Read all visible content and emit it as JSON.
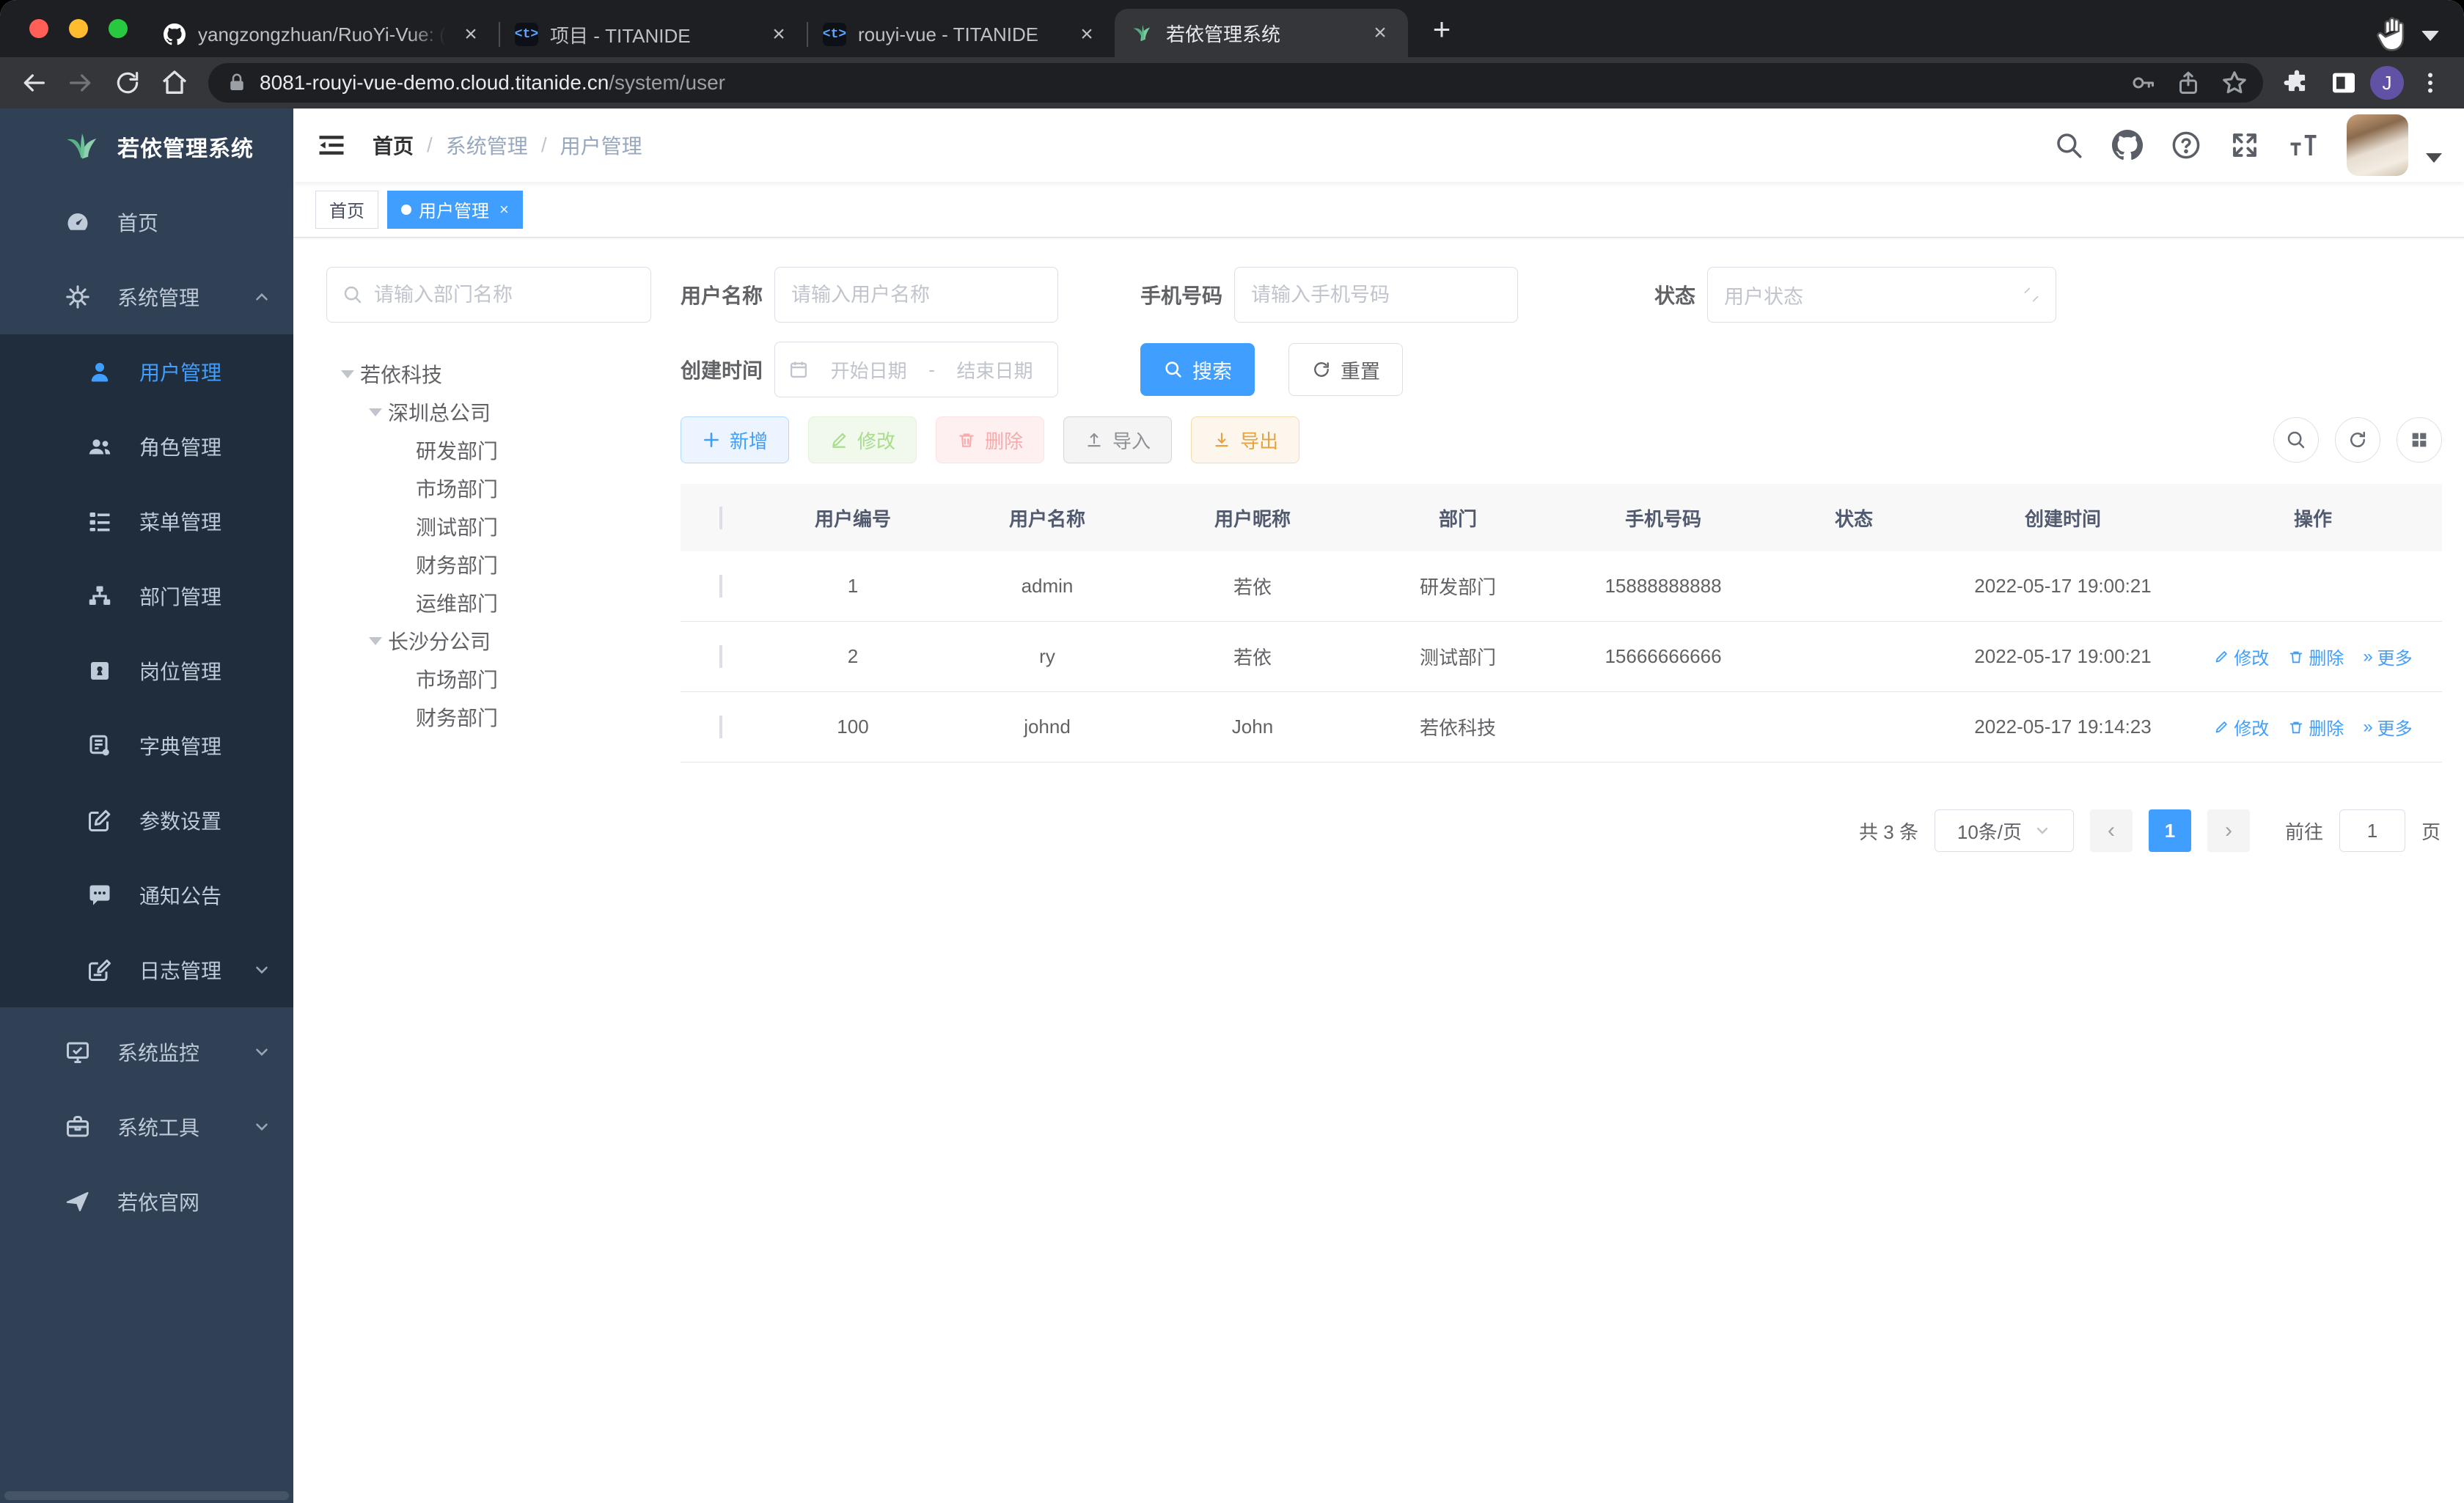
{
  "browser": {
    "tabs": [
      {
        "title": "yangzongzhuan/RuoYi-Vue: (Ru",
        "icon": "github-icon"
      },
      {
        "title": "项目 - TITANIDE",
        "icon": "titanide-code-icon"
      },
      {
        "title": "rouyi-vue - TITANIDE",
        "icon": "titanide-code-icon"
      },
      {
        "title": "若依管理系统",
        "icon": "ruoyi-leaf-icon"
      }
    ],
    "url_host": "8081-rouyi-vue-demo.cloud.titanide.cn",
    "url_path": "/system/user",
    "avatar_letter": "J"
  },
  "icons": {
    "close": "×",
    "new_tab": "+",
    "prev": "‹",
    "next": "›",
    "more": "»",
    "question": "?"
  },
  "sidebar": {
    "logo_title": "若依管理系统",
    "items": [
      {
        "label": "首页"
      },
      {
        "label": "系统管理"
      },
      {
        "label": "系统监控"
      },
      {
        "label": "系统工具"
      },
      {
        "label": "若依官网"
      }
    ],
    "system_submenu": [
      {
        "label": "用户管理"
      },
      {
        "label": "角色管理"
      },
      {
        "label": "菜单管理"
      },
      {
        "label": "部门管理"
      },
      {
        "label": "岗位管理"
      },
      {
        "label": "字典管理"
      },
      {
        "label": "参数设置"
      },
      {
        "label": "通知公告"
      },
      {
        "label": "日志管理"
      }
    ]
  },
  "navbar": {
    "breadcrumb": [
      "首页",
      "系统管理",
      "用户管理"
    ]
  },
  "tags": [
    {
      "label": "首页"
    },
    {
      "label": "用户管理"
    }
  ],
  "dept_tree": {
    "search_placeholder": "请输入部门名称",
    "nodes": [
      {
        "label": "若依科技"
      },
      {
        "label": "深圳总公司"
      },
      {
        "label": "研发部门"
      },
      {
        "label": "市场部门"
      },
      {
        "label": "测试部门"
      },
      {
        "label": "财务部门"
      },
      {
        "label": "运维部门"
      },
      {
        "label": "长沙分公司"
      },
      {
        "label": "市场部门"
      },
      {
        "label": "财务部门"
      }
    ]
  },
  "filters": {
    "username_label": "用户名称",
    "username_placeholder": "请输入用户名称",
    "phone_label": "手机号码",
    "phone_placeholder": "请输入手机号码",
    "status_label": "状态",
    "status_placeholder": "用户状态",
    "created_label": "创建时间",
    "date_start_placeholder": "开始日期",
    "date_separator": "-",
    "date_end_placeholder": "结束日期",
    "search_button": "搜索",
    "reset_button": "重置"
  },
  "toolbar": {
    "add": "新增",
    "edit": "修改",
    "delete": "删除",
    "import": "导入",
    "export": "导出"
  },
  "table": {
    "columns": [
      "用户编号",
      "用户名称",
      "用户昵称",
      "部门",
      "手机号码",
      "状态",
      "创建时间",
      "操作"
    ],
    "rows": [
      {
        "id": "1",
        "username": "admin",
        "nickname": "若依",
        "dept": "研发部门",
        "phone": "15888888888",
        "created": "2022-05-17 19:00:21"
      },
      {
        "id": "2",
        "username": "ry",
        "nickname": "若依",
        "dept": "测试部门",
        "phone": "15666666666",
        "created": "2022-05-17 19:00:21"
      },
      {
        "id": "100",
        "username": "johnd",
        "nickname": "John",
        "dept": "若依科技",
        "phone": "",
        "created": "2022-05-17 19:14:23"
      }
    ],
    "actions": {
      "edit": "修改",
      "delete": "删除",
      "more": "更多"
    }
  },
  "pagination": {
    "total": "共 3 条",
    "page_size": "10条/页",
    "page": "1",
    "goto": "前往",
    "unit": "页"
  },
  "colors": {
    "primary": "#409EFF",
    "sidebar_bg": "#304156",
    "submenu_bg": "#1F2D3D",
    "tag_active": "#409EFF",
    "switch_on": "#409EFF"
  }
}
